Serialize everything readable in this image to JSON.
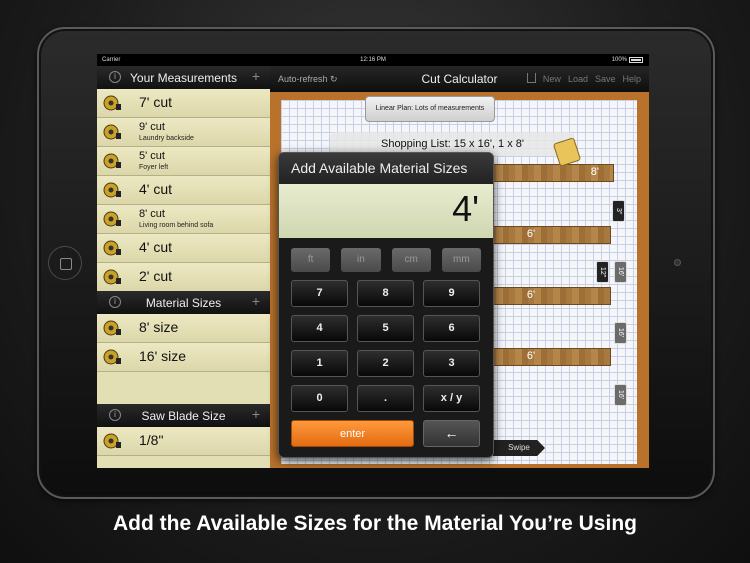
{
  "status": {
    "carrier": "Carrier",
    "time": "12:16 PM",
    "battery": "100%"
  },
  "left": {
    "measurements_header": "Your Measurements",
    "measurements": [
      {
        "main": "7' cut",
        "sub": ""
      },
      {
        "main": "9' cut",
        "sub": "Laundry backside"
      },
      {
        "main": "5' cut",
        "sub": "Foyer left"
      },
      {
        "main": "4' cut",
        "sub": ""
      },
      {
        "main": "8' cut",
        "sub": "Living room behind sofa"
      },
      {
        "main": "4' cut",
        "sub": ""
      },
      {
        "main": "2' cut",
        "sub": ""
      }
    ],
    "material_header": "Material Sizes",
    "materials": [
      "8' size",
      "16' size"
    ],
    "saw_header": "Saw Blade Size",
    "saw_sizes": [
      "1/8\""
    ]
  },
  "nav": {
    "autorefresh": "Auto-refresh",
    "title": "Cut Calculator",
    "buttons": [
      "New",
      "Load",
      "Save",
      "Help"
    ]
  },
  "plan": {
    "tab_label": "Linear Plan: Lots of measurements",
    "shopping_list": "Shopping List: 15 x 16', 1 x 8'",
    "boards": [
      "8'",
      "6'",
      "6'",
      "6'"
    ],
    "tags": [
      "3\"",
      "12\"",
      "16'",
      "16'",
      "16'"
    ],
    "swipe": "Swipe"
  },
  "keypad": {
    "title": "Add Available Material Sizes",
    "display": "4'",
    "units": [
      "ft",
      "in",
      "cm",
      "mm"
    ],
    "keys": [
      "7",
      "8",
      "9",
      "4",
      "5",
      "6",
      "1",
      "2",
      "3",
      "0",
      ".",
      "x / y"
    ],
    "enter": "enter",
    "backspace": "←"
  },
  "caption": "Add the Available Sizes for the Material You’re Using"
}
